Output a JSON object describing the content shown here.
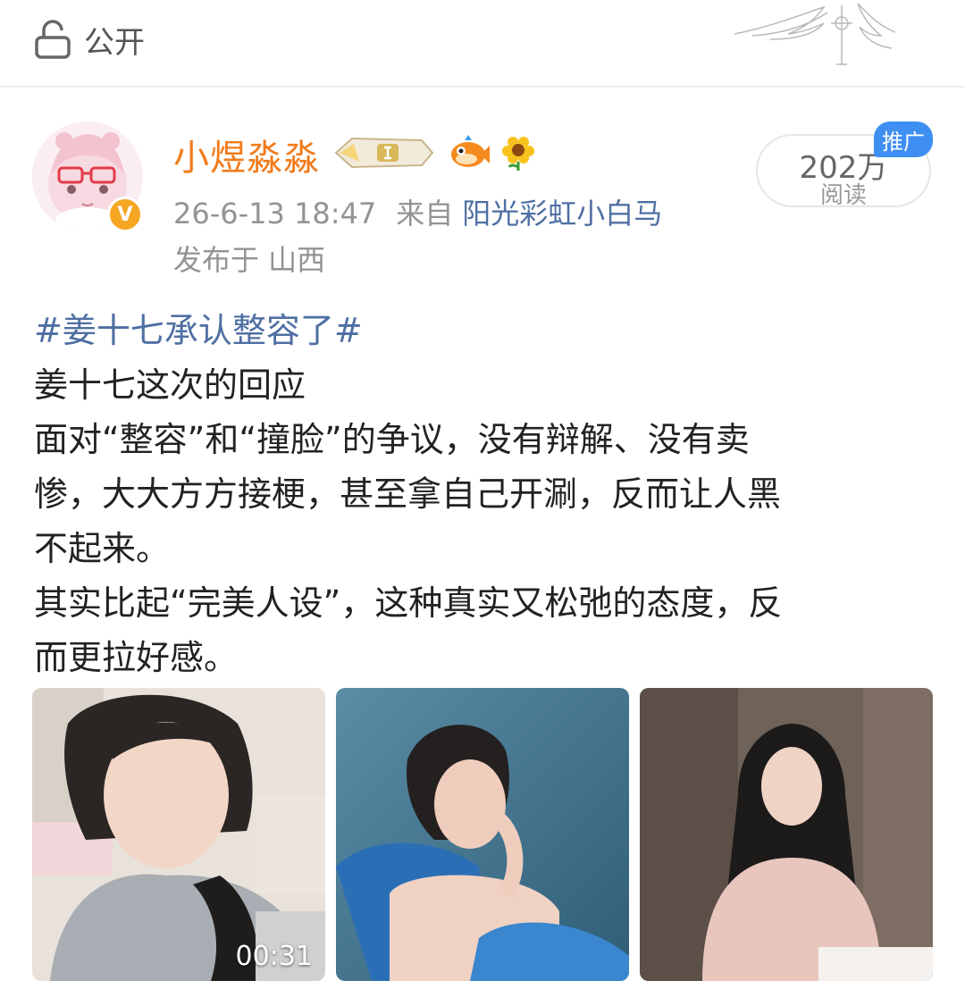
{
  "header": {
    "visibility_label": "公开",
    "visibility_icon": "lock-open-icon"
  },
  "post": {
    "author": {
      "name": "小煜淼淼",
      "verified_badge": "V",
      "name_color": "#f17b1a",
      "badges": [
        "level-badge-icon",
        "fish-icon",
        "sunflower-icon"
      ]
    },
    "time": "26-6-13 18:47",
    "from_label": "来自",
    "source": "阳光彩虹小白马",
    "location": "发布于 山西",
    "reads_count": "202万",
    "reads_label": "阅读",
    "ad_tag": "推广",
    "topic": "#姜十七承认整容了#",
    "lines": [
      "姜十七这次的回应",
      "面对“整容”和“撞脸”的争议，没有辩解、没有卖",
      "惨，大大方方接梗，甚至拿自己开涮，反而让人黑",
      "不起来。",
      "其实比起“完美人设”，这种真实又松弛的态度，反",
      "而更拉好感。"
    ],
    "images": [
      {
        "name": "video-thumbnail",
        "duration": "00:31"
      },
      {
        "name": "photo-thumbnail-2"
      },
      {
        "name": "photo-thumbnail-3"
      }
    ]
  },
  "colors": {
    "link": "#4f6fa3",
    "meta": "#939393",
    "ad_tag_bg": "#3f8ef2"
  }
}
